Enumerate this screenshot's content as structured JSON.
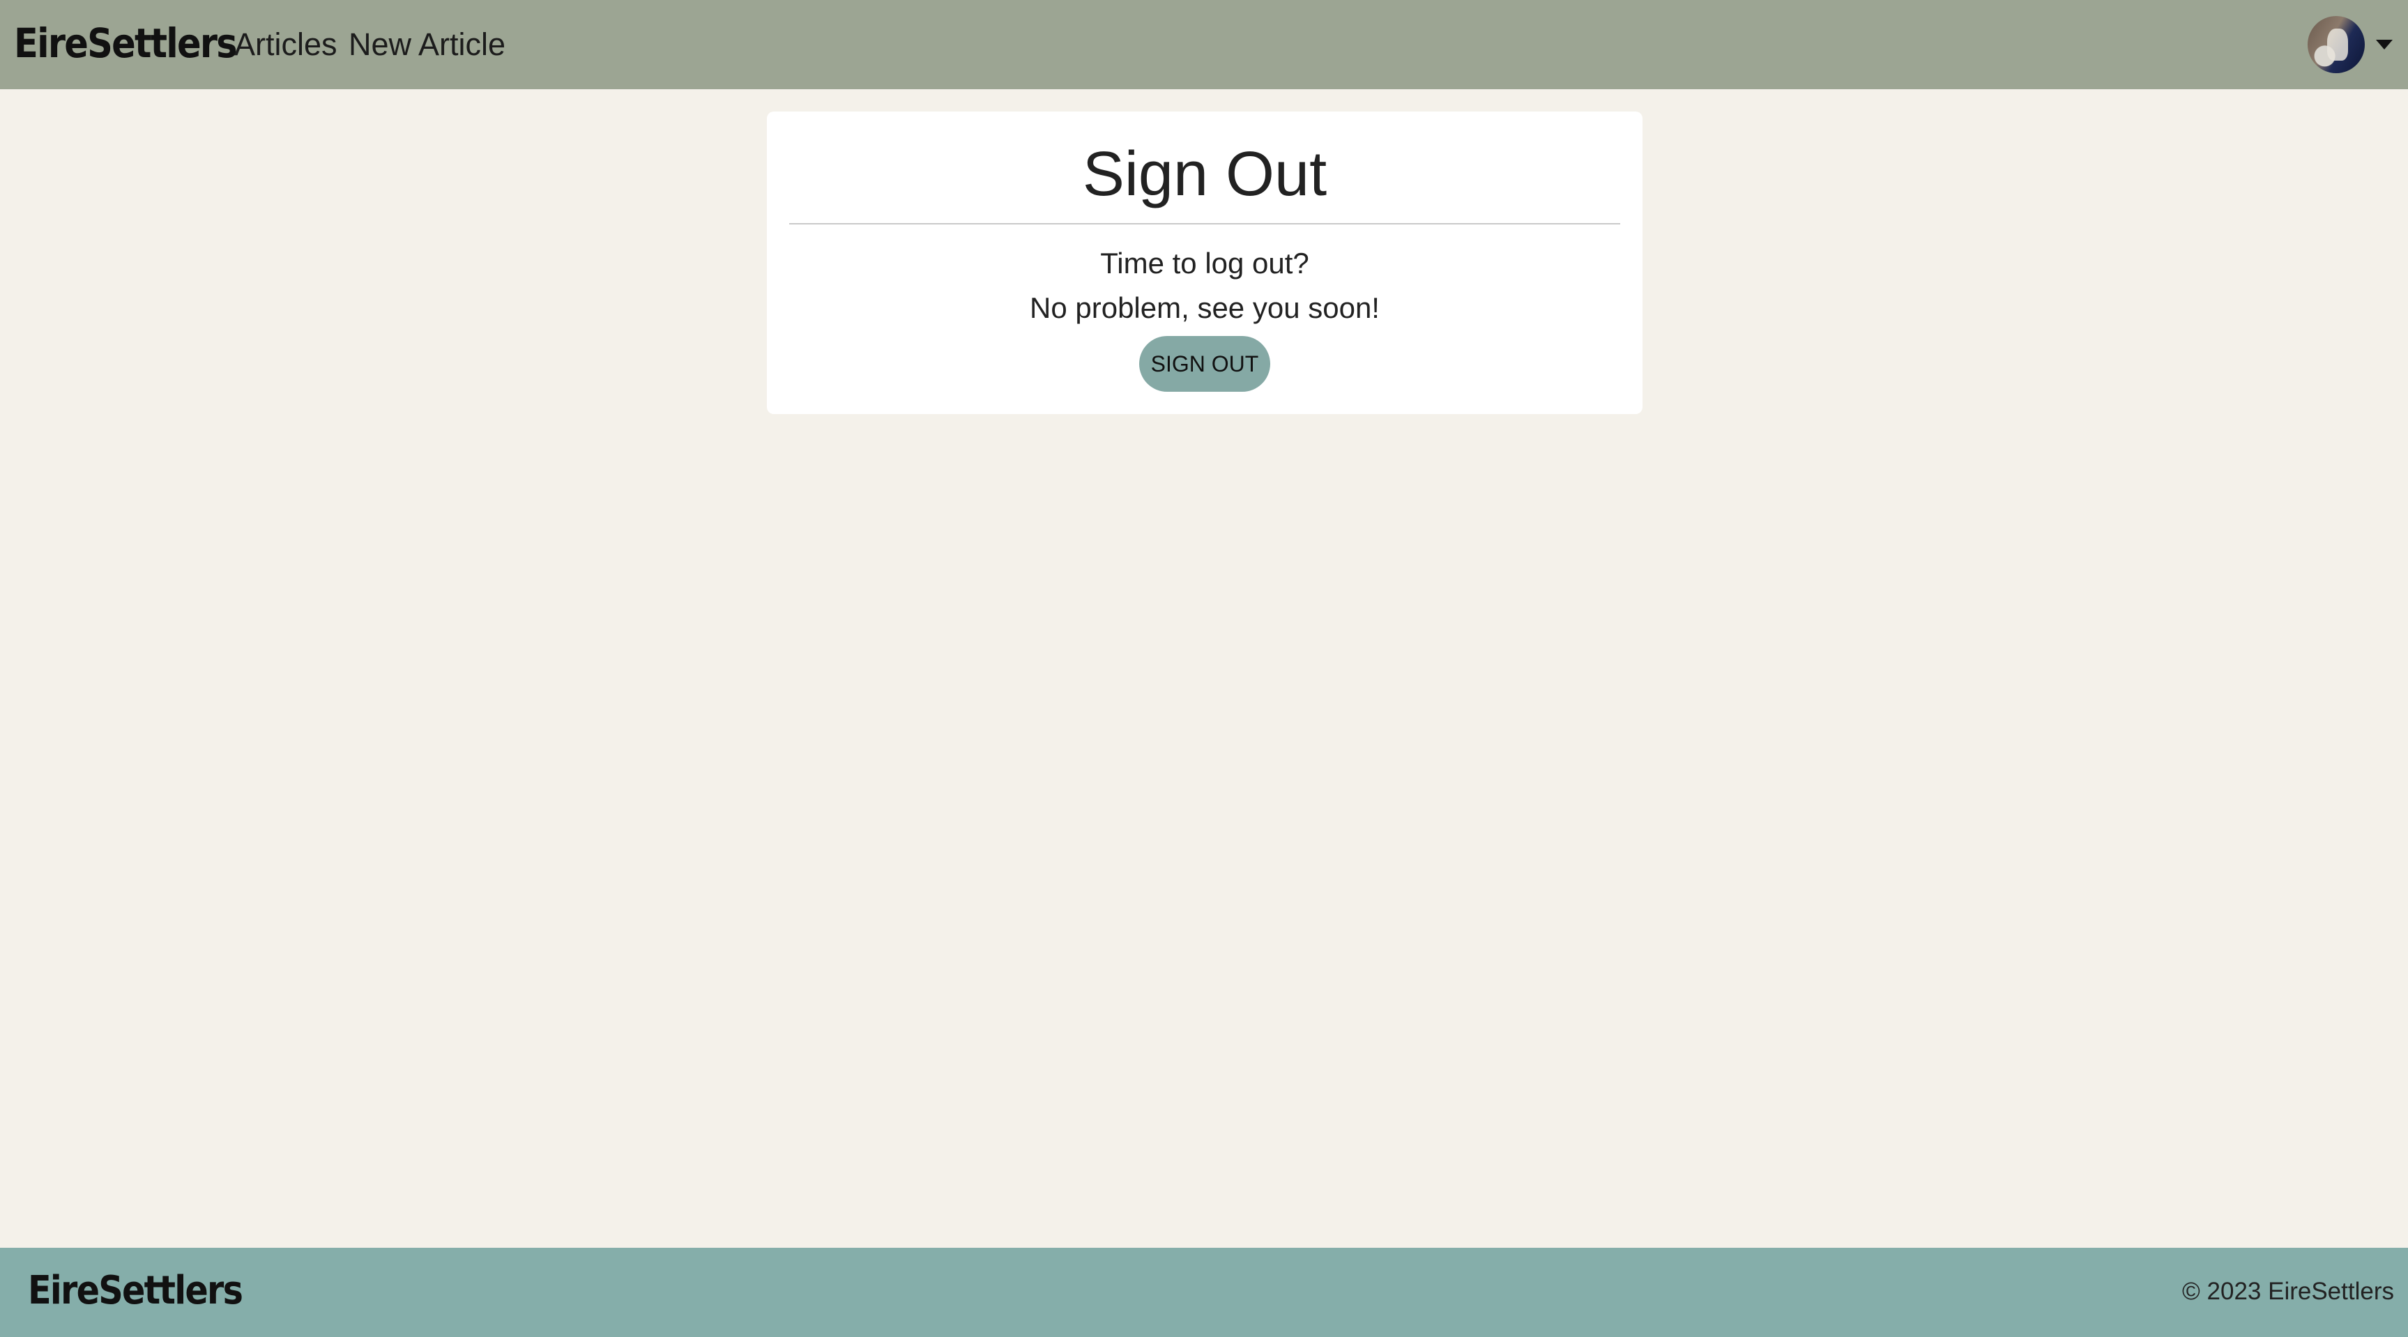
{
  "navbar": {
    "brand": "EireSettlers",
    "links": [
      {
        "label": "Articles"
      },
      {
        "label": "New Article"
      }
    ],
    "avatar_icon": "user-avatar",
    "dropdown_icon": "caret-down-icon"
  },
  "card": {
    "title": "Sign Out",
    "line1": "Time to log out?",
    "line2": "No problem, see you soon!",
    "button_label": "SIGN OUT"
  },
  "footer": {
    "brand": "EireSettlers",
    "copyright": "© 2023 EireSettlers"
  },
  "colors": {
    "navbar_bg": "#9ca593",
    "page_bg": "#f4f1ea",
    "card_bg": "#ffffff",
    "button_bg": "#85a9a5",
    "footer_bg": "#85aeaa"
  }
}
